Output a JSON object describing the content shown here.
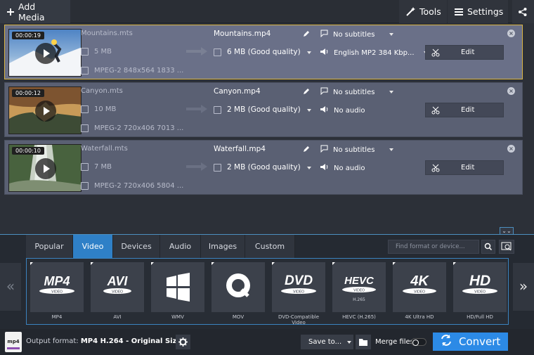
{
  "toolbar": {
    "add_media": "Add Media",
    "tools": "Tools",
    "settings": "Settings"
  },
  "files": [
    {
      "duration": "00:00:19",
      "source_name": "Mountains.mts",
      "source_size": "5 MB",
      "source_info": "MPEG-2 848x564 1833 ...",
      "output_name": "Mountains.mp4",
      "output_size": "6 MB (Good quality)",
      "subtitles": "No subtitles",
      "audio": "English MP2 384 Kbp...",
      "edit_label": "Edit",
      "thumb_colors": [
        "#5a86c0",
        "#f1f3f6",
        "#9aa7b8"
      ]
    },
    {
      "duration": "00:00:12",
      "source_name": "Canyon.mts",
      "source_size": "10 MB",
      "source_info": "MPEG-2 720x406 7013 ...",
      "output_name": "Canyon.mp4",
      "output_size": "2 MB (Good quality)",
      "subtitles": "No subtitles",
      "audio": "No audio",
      "edit_label": "Edit",
      "thumb_colors": [
        "#8a5b34",
        "#c79a5c",
        "#43513a"
      ]
    },
    {
      "duration": "00:00:10",
      "source_name": "Waterfall.mts",
      "source_size": "7 MB",
      "source_info": "MPEG-2 720x406 5804 ...",
      "output_name": "Waterfall.mp4",
      "output_size": "2 MB (Good quality)",
      "subtitles": "No subtitles",
      "audio": "No audio",
      "edit_label": "Edit",
      "thumb_colors": [
        "#2d4f26",
        "#8c9b82",
        "#5d744c"
      ]
    }
  ],
  "tabs": [
    "Popular",
    "Video",
    "Devices",
    "Audio",
    "Images",
    "Custom"
  ],
  "active_tab": "Video",
  "search_placeholder": "Find format or device...",
  "formats": [
    {
      "logo": "MP4",
      "sub": "VIDEO",
      "name": "MP4"
    },
    {
      "logo": "AVI",
      "sub": "VIDEO",
      "name": "AVI"
    },
    {
      "logo": "",
      "sub": "",
      "name": "WMV"
    },
    {
      "logo": "Q",
      "sub": "",
      "name": "MOV"
    },
    {
      "logo": "DVD",
      "sub": "VIDEO",
      "name": "DVD-Compatible Video"
    },
    {
      "logo": "HEVC",
      "sub": "VIDEO",
      "name": "HEVC (H.265)",
      "extra": "H.265"
    },
    {
      "logo": "4K",
      "sub": "VIDEO",
      "name": "4K Ultra HD"
    },
    {
      "logo": "HD",
      "sub": "VIDEO",
      "name": "HD/Full HD"
    }
  ],
  "footer": {
    "format_icon": "mp4",
    "output_prefix": "Output format:",
    "output_format": "MP4 H.264",
    "output_sep": " - ",
    "output_quality": "Original Size",
    "save_to": "Save to...",
    "merge_files": "Merge files",
    "convert": "Convert"
  },
  "colors": {
    "accent": "#2f80c7",
    "convert": "#2c8ae6",
    "selected_border": "#d9b544"
  }
}
